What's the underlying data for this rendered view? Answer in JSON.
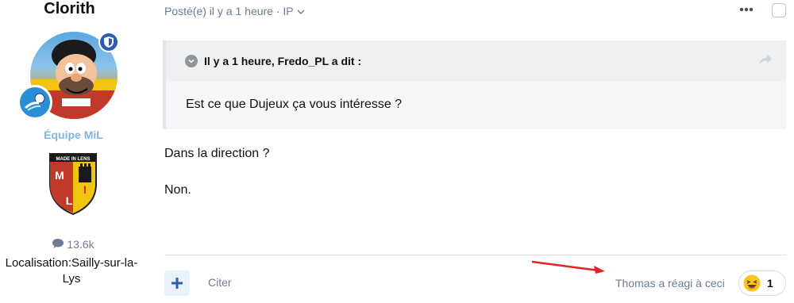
{
  "author": {
    "name": "Clorith",
    "group": "Équipe MiL",
    "logo_text": "MADE IN LENS",
    "posts": "13.6k",
    "location": "Localisation:Sailly-sur-la-Lys"
  },
  "post": {
    "meta": "Posté(e) il y a 1 heure · IP",
    "quote": {
      "title": "Il y a 1 heure, Fredo_PL a dit :",
      "text": "Est ce que Dujeux ça vous intéresse ?"
    },
    "paragraphs": [
      "Dans la direction ?",
      "Non."
    ]
  },
  "footer": {
    "quote_label": "Citer",
    "reacted_text": "Thomas a réagi à ceci",
    "reaction_count": "1"
  },
  "colors": {
    "accent": "#2f5db3",
    "group": "#7fb6d9",
    "arrow": "#e02424"
  },
  "icons": [
    "shield-icon",
    "football-icon",
    "comment-icon",
    "chevron-down-icon",
    "more-icon",
    "share-icon",
    "plus-icon",
    "laughing-emoji-icon"
  ]
}
